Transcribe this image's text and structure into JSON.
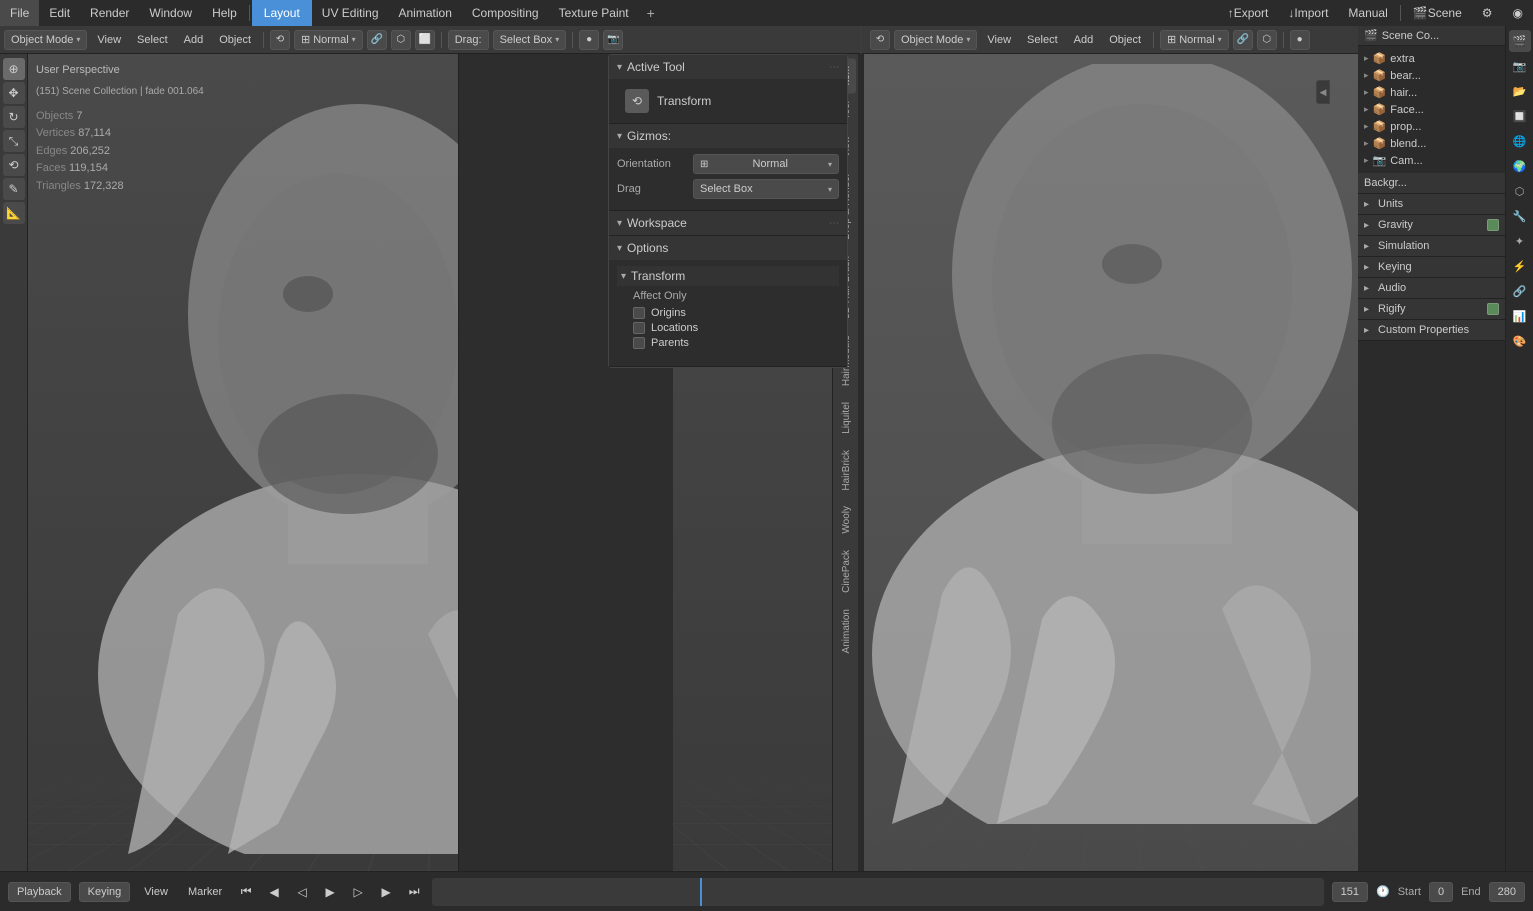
{
  "topMenu": {
    "items": [
      "File",
      "Edit",
      "Render",
      "Window",
      "Help"
    ],
    "tabs": [
      "Layout",
      "UV Editing",
      "Animation",
      "Compositing",
      "Texture Paint"
    ],
    "activeTab": "Layout",
    "rightItems": [
      "Export",
      "Import",
      "Manual",
      "Scene"
    ],
    "addTabLabel": "+"
  },
  "viewportLeft": {
    "modeLabel": "Object Mode",
    "viewLabel": "View",
    "selectLabel": "Select",
    "addLabel": "Add",
    "objectLabel": "Object",
    "normalLabel": "Normal",
    "dragLabel": "Drag:",
    "selectBoxLabel": "Select Box",
    "perspLabel": "User Perspective",
    "sceneInfo": "(151) Scene Collection | fade 001.064",
    "stats": {
      "objects": {
        "label": "Objects",
        "value": "7"
      },
      "vertices": {
        "label": "Vertices",
        "value": "87,114"
      },
      "edges": {
        "label": "Edges",
        "value": "206,252"
      },
      "faces": {
        "label": "Faces",
        "value": "119,154"
      },
      "triangles": {
        "label": "Triangles",
        "value": "172,328"
      }
    }
  },
  "viewportRight": {
    "modeLabel": "Object Mode",
    "viewLabel": "View",
    "selectLabel": "Select",
    "addLabel": "Add",
    "objectLabel": "Object",
    "normalLabel": "Normal"
  },
  "optionsPanel": {
    "title": "Options",
    "sections": {
      "activeTool": {
        "header": "Active Tool",
        "toolName": "Transform"
      },
      "gizmos": {
        "header": "Gizmos",
        "orientationLabel": "Orientation",
        "orientationValue": "Normal",
        "dragLabel": "Drag",
        "dragValue": "Select Box"
      },
      "workspace": {
        "header": "Workspace"
      },
      "options": {
        "header": "Options",
        "transform": {
          "header": "Transform",
          "affectOnly": "Affect Only",
          "origins": "Origins",
          "locations": "Locations",
          "parents": "Parents"
        }
      }
    }
  },
  "sidebarTabs": [
    "Item",
    "Tool",
    "View",
    "Drop & Render",
    "3D Hair Brush",
    "HairModule",
    "Liquitel",
    "HairBrick",
    "Wooly",
    "CinePack",
    "Animation"
  ],
  "rightPanel": {
    "sceneLabel": "Scene Co...",
    "treeItems": [
      {
        "label": "extra",
        "icon": "▸",
        "indent": 0
      },
      {
        "label": "bear...",
        "icon": "▸",
        "indent": 0
      },
      {
        "label": "hair...",
        "icon": "▸",
        "indent": 0
      },
      {
        "label": "Face...",
        "icon": "▸",
        "indent": 0
      },
      {
        "label": "prop...",
        "icon": "▸",
        "indent": 0
      },
      {
        "label": "blend...",
        "icon": "▸",
        "indent": 0
      },
      {
        "label": "Cam...",
        "icon": "▸",
        "indent": 0
      }
    ],
    "sections": [
      {
        "label": "Units"
      },
      {
        "label": "Gravity"
      },
      {
        "label": "Simulation"
      },
      {
        "label": "Keying"
      },
      {
        "label": "Audio"
      },
      {
        "label": "Rigify"
      },
      {
        "label": "Custom Properties"
      }
    ],
    "backgroundLabel": "Backgr..."
  },
  "timeline": {
    "playbackLabel": "Playback",
    "keyingLabel": "Keying",
    "viewLabel": "View",
    "markerLabel": "Marker",
    "frameNumber": "151",
    "startLabel": "Start",
    "startValue": "0",
    "endLabel": "End",
    "endValue": "280"
  },
  "icons": {
    "transform": "⟲",
    "cursor": "⊕",
    "move": "✥",
    "rotate": "↻",
    "scale": "⤡",
    "annotate": "✎",
    "measure": "📏",
    "checkbox_empty": "□",
    "checkbox_checked": "☑",
    "arrow_down": "▾",
    "arrow_right": "▶",
    "arrow_left": "◀",
    "scene": "🎬",
    "camera": "📷",
    "world": "🌐",
    "object": "⬡",
    "modifier": "🔧",
    "particles": "✦",
    "physics": "⚡",
    "constraints": "🔗",
    "data": "📊",
    "material": "⬜",
    "render": "📷"
  },
  "colors": {
    "accent": "#4a90d9",
    "active": "#e87d0d",
    "bg_dark": "#2b2b2b",
    "bg_mid": "#3a3a3a",
    "bg_light": "#4a4a4a",
    "border": "#222222",
    "text": "#cccccc",
    "text_dim": "#999999",
    "green": "#5a8a5a",
    "red": "#c84040",
    "blue": "#4a90d9",
    "yellow": "#d4a000"
  }
}
